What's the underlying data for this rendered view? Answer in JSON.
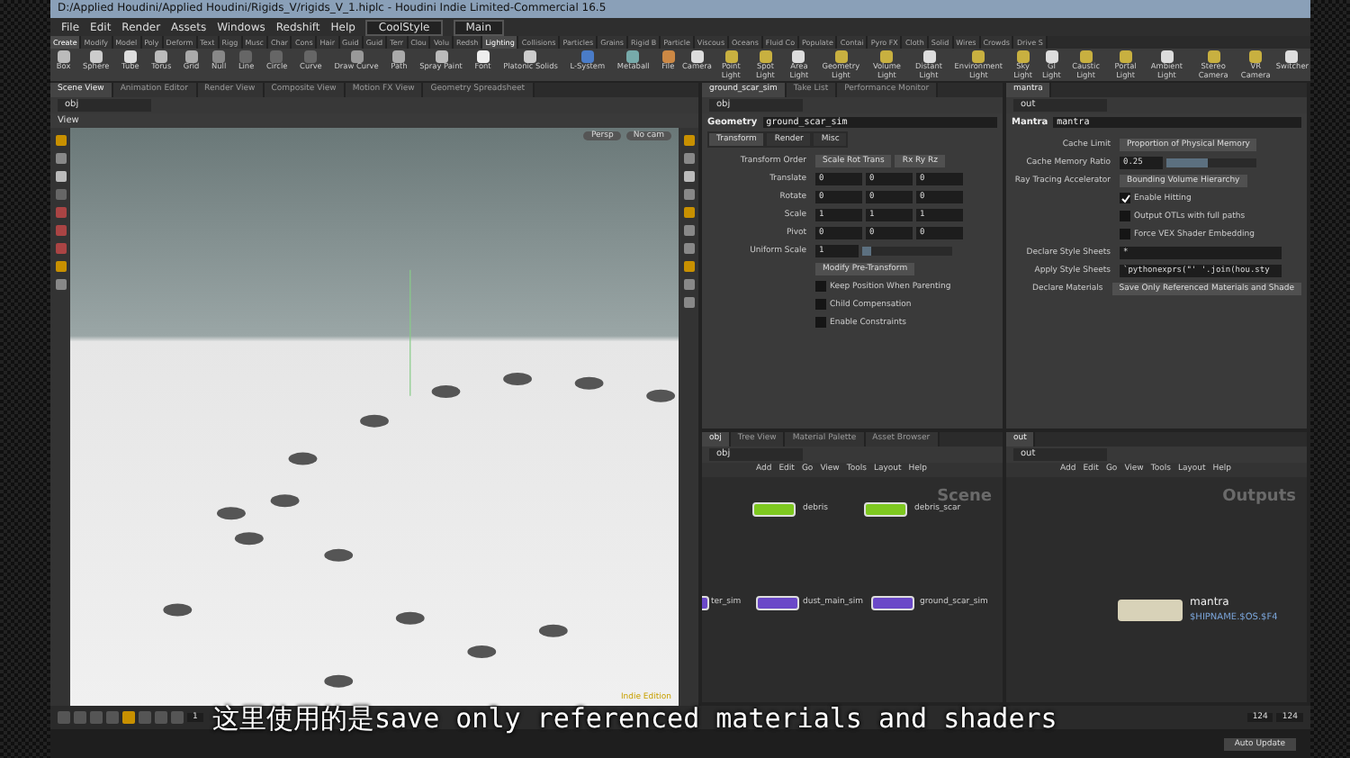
{
  "title_bar": {
    "title": "D:/Applied Houdini/Applied Houdini/Rigids_V/rigids_V_1.hiplc - Houdini Indie Limited-Commercial 16.5"
  },
  "menu_bar": {
    "items": [
      "File",
      "Edit",
      "Render",
      "Assets",
      "Windows",
      "Redshift",
      "Help"
    ],
    "desktop": "CoolStyle",
    "main": "Main"
  },
  "shelf": {
    "tabs_left": [
      {
        "label": "Create",
        "selected": true
      },
      {
        "label": "Modify",
        "selected": false
      },
      {
        "label": "Model",
        "selected": false
      },
      {
        "label": "Poly",
        "selected": false
      },
      {
        "label": "Deform",
        "selected": false
      },
      {
        "label": "Text",
        "selected": false
      },
      {
        "label": "Rigg",
        "selected": false
      },
      {
        "label": "Musc",
        "selected": false
      },
      {
        "label": "Char",
        "selected": false
      },
      {
        "label": "Cons",
        "selected": false
      },
      {
        "label": "Hair",
        "selected": false
      },
      {
        "label": "Guid",
        "selected": false
      },
      {
        "label": "Guid",
        "selected": false
      },
      {
        "label": "Terr",
        "selected": false
      },
      {
        "label": "Clou",
        "selected": false
      },
      {
        "label": "Volu",
        "selected": false
      },
      {
        "label": "Redsh",
        "selected": false
      }
    ],
    "tabs_right": [
      {
        "label": "Lighting",
        "selected": true
      },
      {
        "label": "Collisions",
        "selected": false
      },
      {
        "label": "Particles",
        "selected": false
      },
      {
        "label": "Grains",
        "selected": false
      },
      {
        "label": "Rigid B",
        "selected": false
      },
      {
        "label": "Particle",
        "selected": false
      },
      {
        "label": "Viscous",
        "selected": false
      },
      {
        "label": "Oceans",
        "selected": false
      },
      {
        "label": "Fluid Co",
        "selected": false
      },
      {
        "label": "Populate",
        "selected": false
      },
      {
        "label": "Contai",
        "selected": false
      },
      {
        "label": "Pyro FX",
        "selected": false
      },
      {
        "label": "Cloth",
        "selected": false
      },
      {
        "label": "Solid",
        "selected": false
      },
      {
        "label": "Wires",
        "selected": false
      },
      {
        "label": "Crowds",
        "selected": false
      },
      {
        "label": "Drive S",
        "selected": false
      }
    ],
    "tools_left": [
      "Box",
      "Sphere",
      "Tube",
      "Torus",
      "Grid",
      "Null",
      "Line",
      "Circle",
      "Curve",
      "Draw Curve",
      "Path",
      "Spray Paint",
      "Font",
      "Platonic Solids",
      "L-System",
      "Metaball",
      "File"
    ],
    "tools_right": [
      "Camera",
      "Point Light",
      "Spot Light",
      "Area Light",
      "Geometry Light",
      "Volume Light",
      "Distant Light",
      "Environment Light",
      "Sky Light",
      "GI Light",
      "Caustic Light",
      "Portal Light",
      "Ambient Light",
      "Stereo Camera",
      "VR Camera",
      "Switcher"
    ]
  },
  "left_pane": {
    "tabs": [
      {
        "label": "Scene View",
        "selected": true
      },
      {
        "label": "Animation Editor",
        "selected": false
      },
      {
        "label": "Render View",
        "selected": false
      },
      {
        "label": "Composite View",
        "selected": false
      },
      {
        "label": "Motion FX View",
        "selected": false
      },
      {
        "label": "Geometry Spreadsheet",
        "selected": false
      }
    ],
    "path": "obj",
    "title": "View",
    "view_buttons": [
      "Persp",
      "No cam"
    ],
    "edition": "Indie Edition"
  },
  "geometry_panel": {
    "tabs": [
      {
        "label": "ground_scar_sim",
        "selected": true
      },
      {
        "label": "Take List",
        "selected": false
      },
      {
        "label": "Performance Monitor",
        "selected": false
      }
    ],
    "path": "obj",
    "type": "Geometry",
    "name": "ground_scar_sim",
    "sections": [
      {
        "label": "Transform",
        "selected": true
      },
      {
        "label": "Render",
        "selected": false
      },
      {
        "label": "Misc",
        "selected": false
      }
    ],
    "params": [
      {
        "kind": "menus",
        "label": "Transform Order",
        "values": [
          "Scale Rot Trans",
          "Rx Ry Rz"
        ]
      },
      {
        "kind": "vector",
        "label": "Translate",
        "values": [
          "0",
          "0",
          "0"
        ]
      },
      {
        "kind": "vector",
        "label": "Rotate",
        "values": [
          "0",
          "0",
          "0"
        ]
      },
      {
        "kind": "vector",
        "label": "Scale",
        "values": [
          "1",
          "1",
          "1"
        ]
      },
      {
        "kind": "vector",
        "label": "Pivot",
        "values": [
          "0",
          "0",
          "0"
        ]
      },
      {
        "kind": "slider",
        "label": "Uniform Scale",
        "value": "1",
        "level": 0.1
      },
      {
        "kind": "button",
        "value": "Modify Pre-Transform"
      },
      {
        "kind": "checkbox",
        "label": "Keep Position When Parenting",
        "checked": false
      },
      {
        "kind": "checkbox",
        "label": "Child Compensation",
        "checked": false
      },
      {
        "kind": "checkbox",
        "label": "Enable Constraints",
        "checked": false
      }
    ]
  },
  "mantra_panel": {
    "tabs": [
      {
        "label": "mantra",
        "selected": true
      }
    ],
    "path": "out",
    "type": "Mantra",
    "name": "mantra",
    "params": [
      {
        "kind": "menus",
        "label": "Cache Limit",
        "values": [
          "Proportion of Physical Memory"
        ]
      },
      {
        "kind": "slider",
        "label": "Cache Memory Ratio",
        "value": "0.25",
        "level": 0.45
      },
      {
        "kind": "menus",
        "label": "Ray Tracing Accelerator",
        "values": [
          "Bounding Volume Hierarchy"
        ]
      },
      {
        "kind": "checkbox",
        "label": "Enable Hitting",
        "checked": true
      },
      {
        "kind": "checkbox",
        "label": "Output OTLs with full paths",
        "checked": false
      },
      {
        "kind": "checkbox",
        "label": "Force VEX Shader Embedding",
        "checked": false
      },
      {
        "kind": "field",
        "label": "Declare Style Sheets",
        "value": "*"
      },
      {
        "kind": "field",
        "label": "Apply Style Sheets",
        "value": "`pythonexprs(\"' '.join(hou.sty"
      },
      {
        "kind": "menus",
        "label": "Declare Materials",
        "values": [
          "Save Only Referenced Materials and Shade"
        ]
      }
    ]
  },
  "network_obj": {
    "tabs": [
      {
        "label": "obj",
        "selected": true
      },
      {
        "label": "Tree View",
        "selected": false
      },
      {
        "label": "Material Palette",
        "selected": false
      },
      {
        "label": "Asset Browser",
        "selected": false
      }
    ],
    "path": "obj",
    "menu": [
      "Add",
      "Edit",
      "Go",
      "View",
      "Tools",
      "Layout",
      "Help"
    ],
    "watermark": "Scene",
    "nodes": [
      {
        "name": "debris",
        "color": "#7ec820"
      },
      {
        "name": "debris_scar",
        "color": "#7ec820"
      },
      {
        "name": "ter_sim",
        "color": "#6a48c8"
      },
      {
        "name": "dust_main_sim",
        "color": "#6a48c8"
      },
      {
        "name": "ground_scar_sim",
        "color": "#6a48c8"
      }
    ]
  },
  "network_out": {
    "tabs": [
      {
        "label": "out",
        "selected": true
      }
    ],
    "path": "out",
    "menu": [
      "Add",
      "Edit",
      "Go",
      "View",
      "Tools",
      "Layout",
      "Help"
    ],
    "watermark": "Outputs",
    "nodes": [
      {
        "name": "mantra",
        "output": "$HIPNAME.$OS.$F4"
      }
    ]
  },
  "timeline": {
    "frame": "1",
    "start": "124",
    "end": "124",
    "update": "Auto Update"
  },
  "subtitle": "这里使用的是save only referenced materials and shaders"
}
